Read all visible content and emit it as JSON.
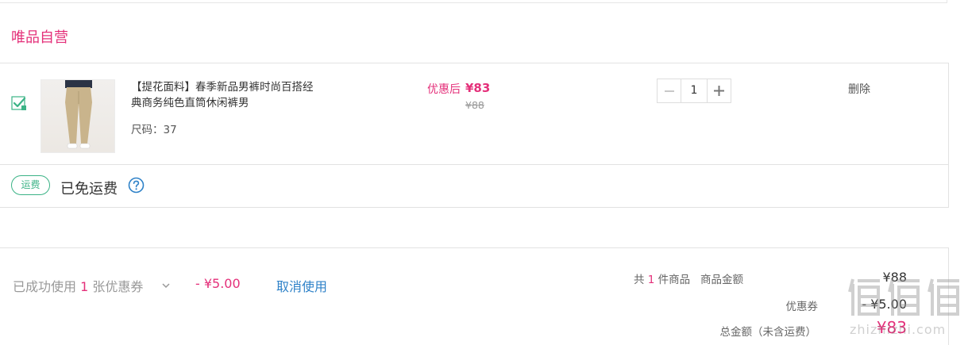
{
  "store": {
    "title": "唯品自营"
  },
  "item": {
    "title": "【提花面料】春季新品男裤时尚百搭经典商务纯色直筒休闲裤男",
    "size_label": "尺码：37",
    "after_coupon_label": "优惠后",
    "after_coupon_price": "¥83",
    "original_price": "¥88",
    "quantity": "1",
    "delete_label": "删除"
  },
  "shipping": {
    "badge": "运费",
    "text": "已免运费"
  },
  "coupon": {
    "prefix": "已成功使用",
    "count": "1",
    "suffix": "张优惠券",
    "amount": "- ¥5.00",
    "cancel_label": "取消使用"
  },
  "summary": {
    "count_prefix": "共",
    "count": "1",
    "count_suffix": "件商品",
    "goods_label": "商品金额",
    "goods_value": "¥88",
    "coupon_label": "优惠券",
    "coupon_value": "- ¥5.00",
    "total_label": "总金额（未含运费）",
    "total_value": "¥83"
  },
  "watermark": {
    "text": "zhizhizhi.com"
  },
  "colors": {
    "accent": "#e4307a",
    "link": "#2f82c8",
    "shipping": "#3bb386"
  },
  "icons": [
    "checkbox-checked-icon",
    "minus-icon",
    "plus-icon",
    "help-icon",
    "chevron-down-icon",
    "watermark-logo"
  ]
}
